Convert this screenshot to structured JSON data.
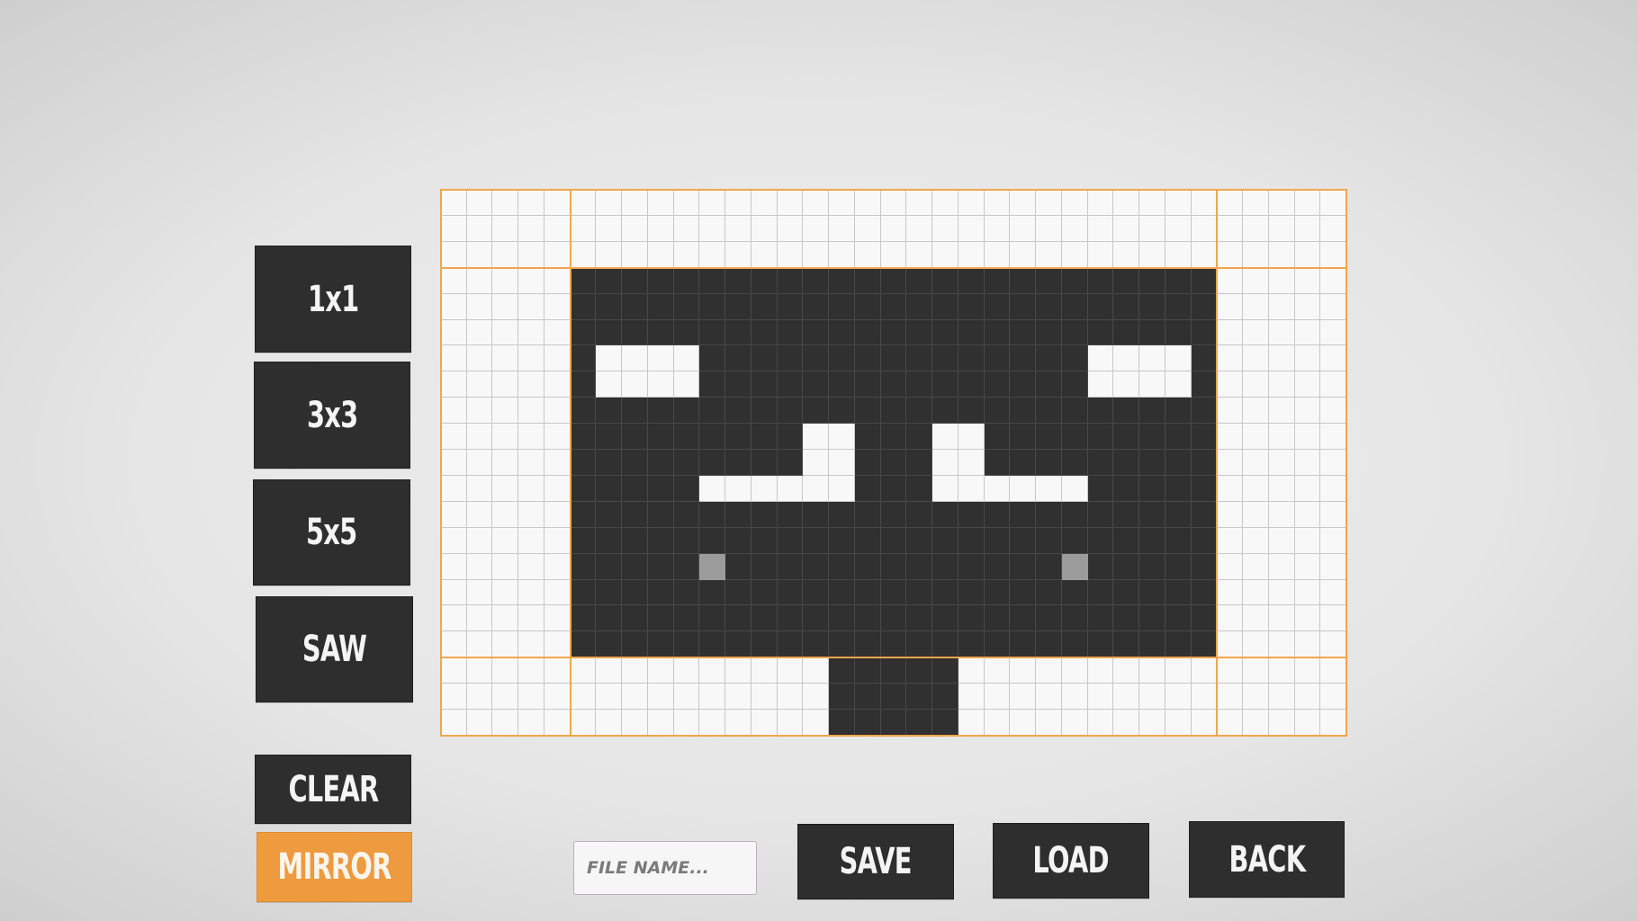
{
  "brush_buttons": [
    {
      "label": "1x1"
    },
    {
      "label": "3x3"
    },
    {
      "label": "5x5"
    },
    {
      "label": "SAW"
    }
  ],
  "actions": {
    "clear_label": "CLEAR",
    "mirror_label": "MIRROR",
    "mirror_active": true,
    "save_label": "SAVE",
    "load_label": "LOAD",
    "back_label": "BACK"
  },
  "file_name": {
    "value": "",
    "placeholder": "FILE NAME..."
  },
  "colors": {
    "accent": "#ee9a3e",
    "dark": "#2e2e2e",
    "cell_empty": "#f8f8f8",
    "cell_filled": "#303030",
    "cell_gray": "#9b9b9b"
  },
  "canvas": {
    "columns": 35,
    "rows": 21,
    "guide_columns": [
      5,
      30
    ],
    "guide_rows": [
      3,
      18
    ],
    "legend": {
      "0": "empty",
      "1": "dark",
      "2": "gray"
    },
    "pixels": [
      "00000000000000000000000000000000000",
      "00000000000000000000000000000000000",
      "00000000000000000000000000000000000",
      "00000111111111111111111111111100000",
      "00000111111111111111111111111100000",
      "00000111111111111111111111111100000",
      "00000100001111111111111110000100000",
      "00000100001111111111111110000100000",
      "00000111111111111111111111111100000",
      "00000111111111001110011111111100000",
      "00000111111111001110011111111100000",
      "00000111110000001110000001111100000",
      "00000111111111111111111111111100000",
      "00000111111111111111111111111100000",
      "00000111112111111111111121111100000",
      "00000111111111111111111111111100000",
      "00000111111111111111111111111100000",
      "00000111111111111111111111111100000",
      "00000000000000011111000000000000000",
      "00000000000000011111000000000000000",
      "00000000000000011111000000000000000"
    ]
  }
}
